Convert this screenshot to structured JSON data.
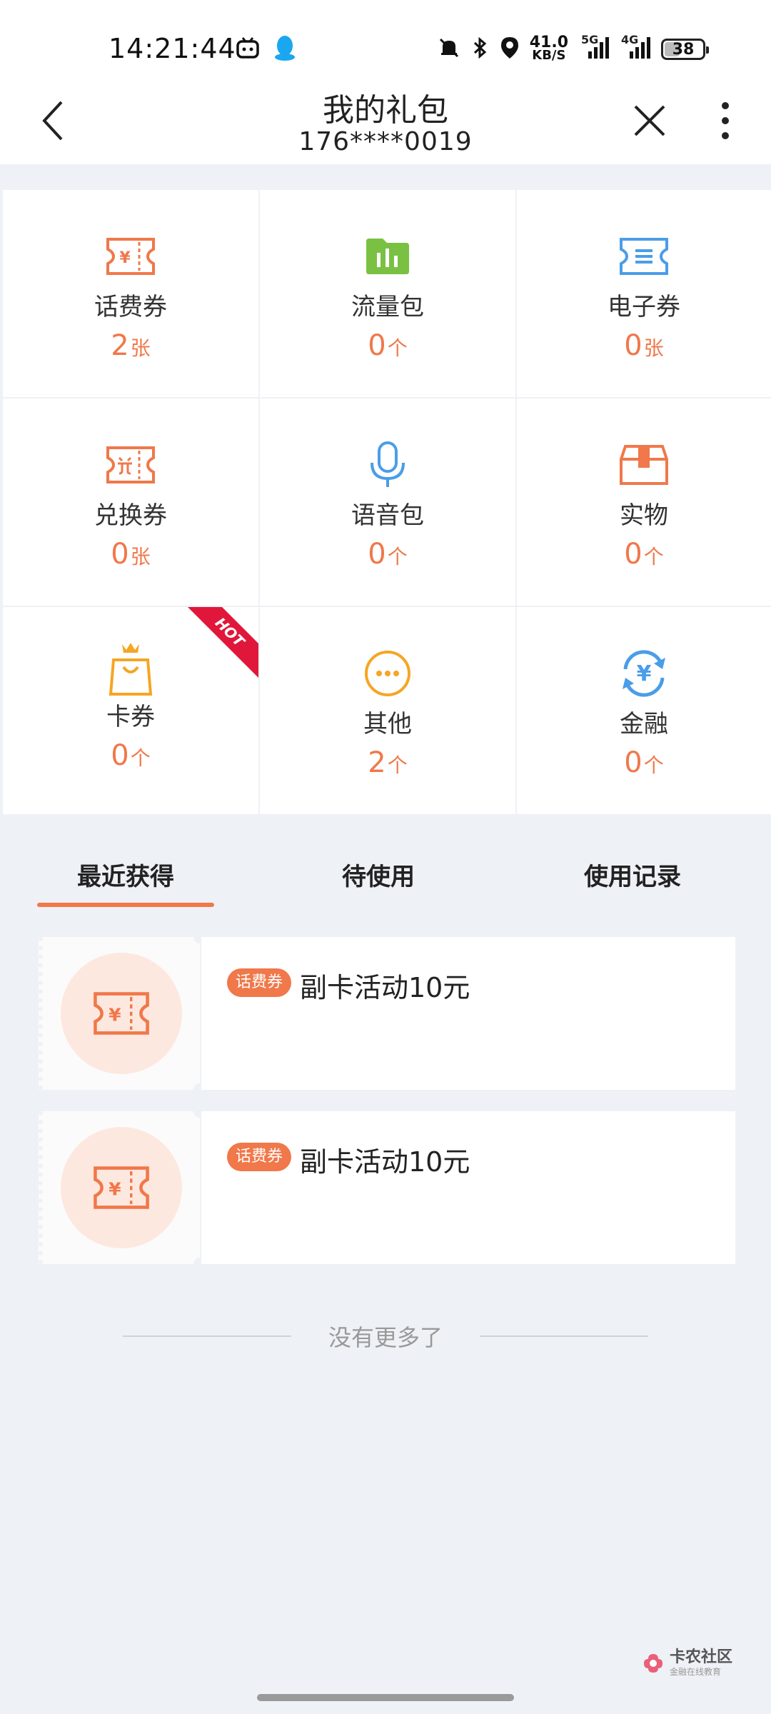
{
  "status_bar": {
    "time": "14:21:44",
    "net_speed_value": "41.0",
    "net_speed_unit": "KB/S",
    "sim1_label": "5G",
    "sim2_label": "4G",
    "battery": "38",
    "battery_level": 0.38
  },
  "header": {
    "title": "我的礼包",
    "subtitle": "176****0019"
  },
  "grid": [
    {
      "label": "话费券",
      "count": "2",
      "unit": "张",
      "icon": "bill-coupon-icon",
      "color": "#f0784a"
    },
    {
      "label": "流量包",
      "count": "0",
      "unit": "个",
      "icon": "data-folder-icon",
      "color": "#7ac143"
    },
    {
      "label": "电子券",
      "count": "0",
      "unit": "张",
      "icon": "e-coupon-icon",
      "color": "#4a9de8"
    },
    {
      "label": "兑换券",
      "count": "0",
      "unit": "张",
      "icon": "exchange-coupon-icon",
      "color": "#f0784a"
    },
    {
      "label": "语音包",
      "count": "0",
      "unit": "个",
      "icon": "microphone-icon",
      "color": "#4a9de8"
    },
    {
      "label": "实物",
      "count": "0",
      "unit": "个",
      "icon": "package-box-icon",
      "color": "#f0784a"
    },
    {
      "label": "卡券",
      "count": "0",
      "unit": "个",
      "icon": "shopping-bag-crown-icon",
      "color": "#f5a623",
      "badge": "HOT"
    },
    {
      "label": "其他",
      "count": "2",
      "unit": "个",
      "icon": "more-dots-icon",
      "color": "#f5a623"
    },
    {
      "label": "金融",
      "count": "0",
      "unit": "个",
      "icon": "yuan-exchange-icon",
      "color": "#4a9de8"
    }
  ],
  "tabs": [
    {
      "label": "最近获得",
      "active": true
    },
    {
      "label": "待使用",
      "active": false
    },
    {
      "label": "使用记录",
      "active": false
    }
  ],
  "coupons": [
    {
      "tag": "话费券",
      "name": "副卡活动10元"
    },
    {
      "tag": "话费券",
      "name": "副卡活动10元"
    }
  ],
  "footer": {
    "no_more": "没有更多了",
    "watermark_title": "卡农社区",
    "watermark_sub": "金融在线教育"
  },
  "colors": {
    "accent": "#f0784a",
    "hot": "#e0173b",
    "background": "#eef1f5"
  }
}
